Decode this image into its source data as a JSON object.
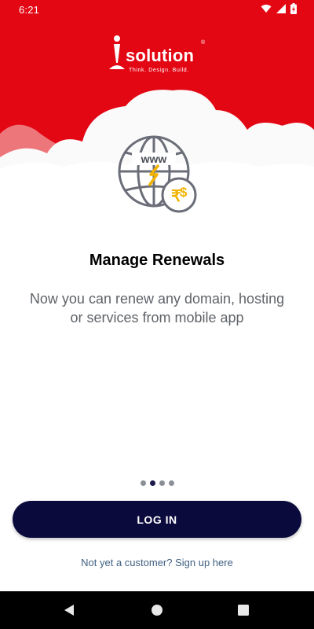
{
  "status_bar": {
    "time": "6:21",
    "icons": [
      "wifi-icon",
      "signal-icon",
      "battery-charging-icon"
    ]
  },
  "brand": {
    "name": "solution",
    "registered": "®",
    "tagline": "Think.   Design.   Build.",
    "primary_color": "#e30613"
  },
  "onboarding": {
    "illustration_icon": "globe-www-rupee-dollar-icon",
    "illustration_text": "www",
    "title": "Manage Renewals",
    "subtitle": "Now you can renew any domain, hosting or services from mobile app",
    "pager": {
      "count": 4,
      "active_index": 1
    }
  },
  "actions": {
    "login_label": "LOG IN",
    "signup_label": "Not yet a customer? Sign up here",
    "button_color": "#0b0a3d"
  },
  "nav_bar": {
    "icons": [
      "back-icon",
      "home-icon",
      "recents-icon"
    ]
  }
}
